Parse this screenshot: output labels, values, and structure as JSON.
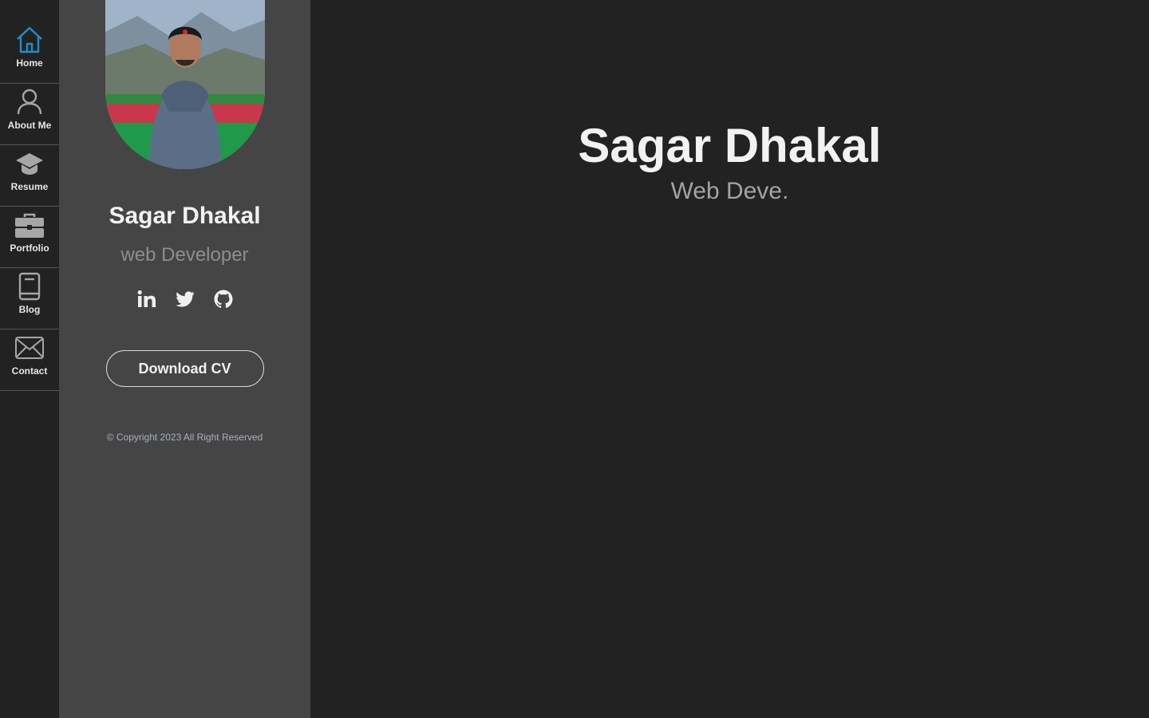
{
  "nav": {
    "items": [
      {
        "label": "Home",
        "icon": "home-icon",
        "active": true
      },
      {
        "label": "About Me",
        "icon": "user-icon",
        "active": false
      },
      {
        "label": "Resume",
        "icon": "graduation-cap-icon",
        "active": false
      },
      {
        "label": "Portfolio",
        "icon": "briefcase-icon",
        "active": false
      },
      {
        "label": "Blog",
        "icon": "book-icon",
        "active": false
      },
      {
        "label": "Contact",
        "icon": "envelope-icon",
        "active": false
      }
    ],
    "active_color": "#1e90c8",
    "icon_color": "#a6a6a6"
  },
  "profile": {
    "avatar_alt": "profile photo",
    "name": "Sagar Dhakal",
    "role": "web Developer",
    "socials": [
      {
        "icon": "linkedin-icon"
      },
      {
        "icon": "twitter-icon"
      },
      {
        "icon": "github-icon"
      }
    ],
    "cv_button": "Download CV",
    "copyright": "© Copyright 2023 All Right Reserved"
  },
  "hero": {
    "name": "Sagar Dhakal",
    "role": "Web Deve."
  }
}
